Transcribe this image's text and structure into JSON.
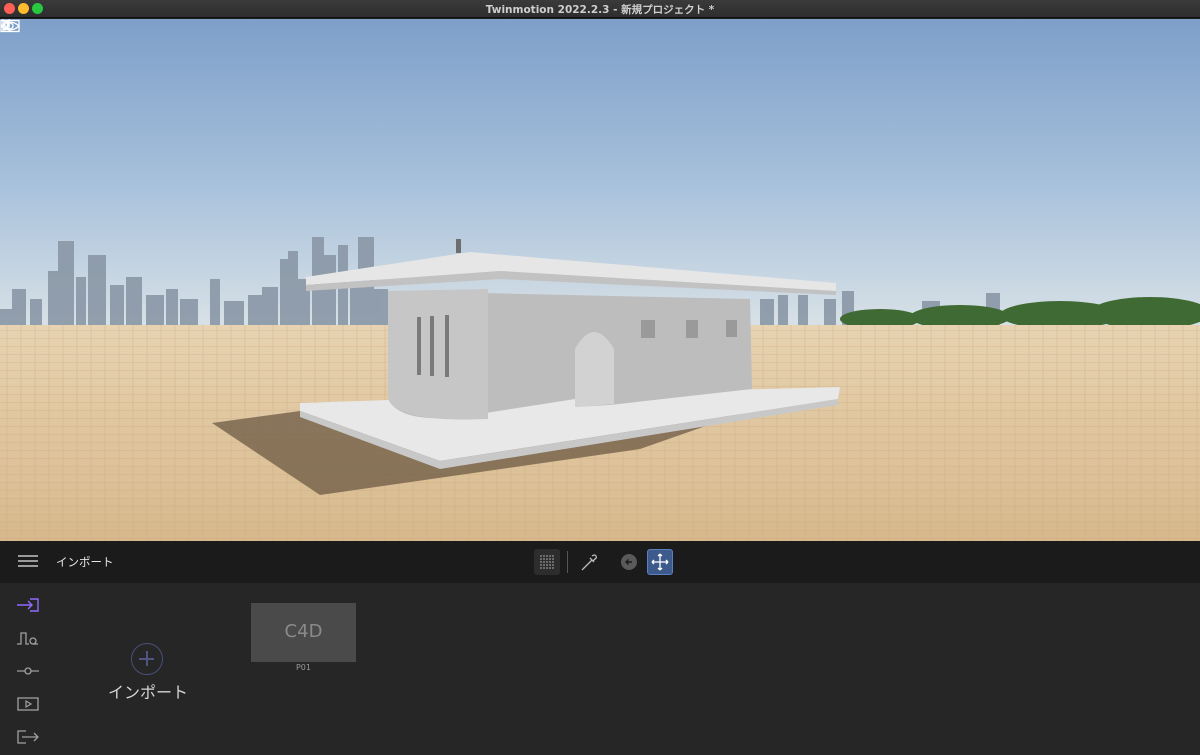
{
  "window": {
    "title": "Twinmotion 2022.2.3 - 新規プロジェクト *"
  },
  "viewport": {
    "icons": [
      "left-panel-toggle",
      "panel-view",
      "eye",
      "right-panel-toggle"
    ]
  },
  "toolbar": {
    "title": "インポート",
    "tools": [
      "grid",
      "picker",
      "back",
      "move"
    ],
    "accent": "#3d5a8c"
  },
  "sidebar": {
    "items": [
      "import",
      "path",
      "slider",
      "media",
      "export"
    ],
    "active_color": "#8e6cff"
  },
  "import": {
    "add_label": "インポート",
    "items": [
      {
        "format": "C4D",
        "name": "P01"
      }
    ]
  }
}
